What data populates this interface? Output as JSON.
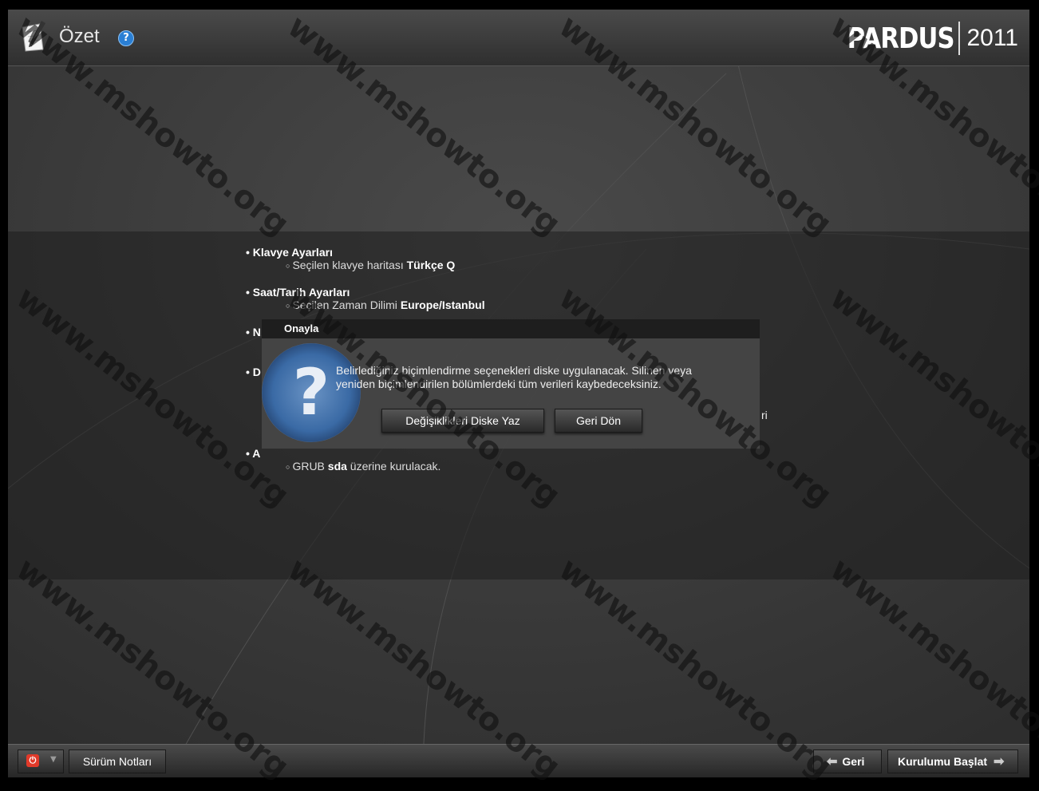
{
  "header": {
    "title": "Özet",
    "help_icon": "help-icon",
    "brand": "PARDUS",
    "year": "2011"
  },
  "summary": {
    "sections": [
      {
        "title": "Klavye Ayarları",
        "item_prefix": "Seçilen klavye haritası ",
        "item_value": "Türkçe Q"
      },
      {
        "title": "Saat/Tarih Ayarları",
        "item_prefix": "Seçilen Zaman Dilimi ",
        "item_value": "Europe/Istanbul"
      },
      {
        "title": "N"
      },
      {
        "title": "D"
      },
      {
        "title": "A",
        "item_prefix": "GRUB ",
        "item_value": "sda",
        "item_suffix": " üzerine kurulacak."
      }
    ],
    "fragment_right": "ri"
  },
  "dialog": {
    "title": "Onayla",
    "message_line1": "Belirlediğiniz biçimlendirme seçenekleri diske uygulanacak. Silinen veya",
    "message_line2": "yeniden biçimlendirilen bölümlerdeki tüm verileri kaybedeceksiniz.",
    "icon": "question-icon",
    "write_button": "Değişiklikleri Diske Yaz",
    "back_button": "Geri Dön"
  },
  "footer": {
    "power_icon": "power-icon",
    "release_notes": "Sürüm Notları",
    "prev": "Geri",
    "start": "Kurulumu Başlat"
  },
  "watermark": "www.mshowto.org"
}
